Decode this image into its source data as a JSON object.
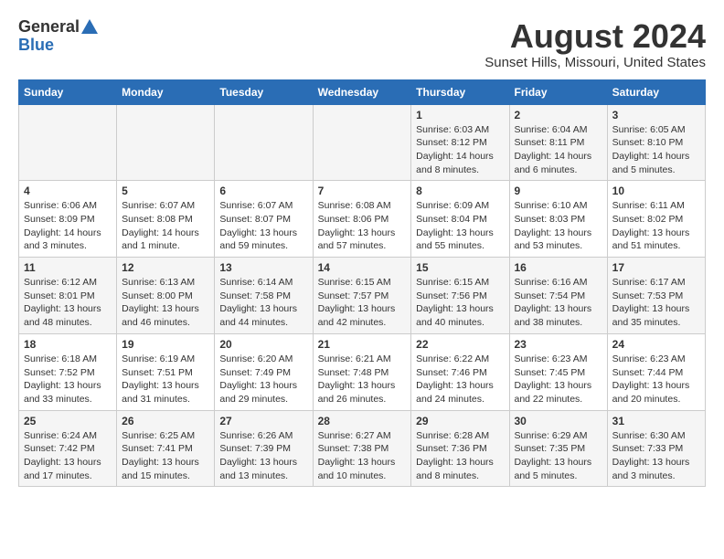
{
  "header": {
    "logo_general": "General",
    "logo_blue": "Blue",
    "month_title": "August 2024",
    "location": "Sunset Hills, Missouri, United States"
  },
  "days_of_week": [
    "Sunday",
    "Monday",
    "Tuesday",
    "Wednesday",
    "Thursday",
    "Friday",
    "Saturday"
  ],
  "weeks": [
    [
      {
        "day": "",
        "info": ""
      },
      {
        "day": "",
        "info": ""
      },
      {
        "day": "",
        "info": ""
      },
      {
        "day": "",
        "info": ""
      },
      {
        "day": "1",
        "info": "Sunrise: 6:03 AM\nSunset: 8:12 PM\nDaylight: 14 hours\nand 8 minutes."
      },
      {
        "day": "2",
        "info": "Sunrise: 6:04 AM\nSunset: 8:11 PM\nDaylight: 14 hours\nand 6 minutes."
      },
      {
        "day": "3",
        "info": "Sunrise: 6:05 AM\nSunset: 8:10 PM\nDaylight: 14 hours\nand 5 minutes."
      }
    ],
    [
      {
        "day": "4",
        "info": "Sunrise: 6:06 AM\nSunset: 8:09 PM\nDaylight: 14 hours\nand 3 minutes."
      },
      {
        "day": "5",
        "info": "Sunrise: 6:07 AM\nSunset: 8:08 PM\nDaylight: 14 hours\nand 1 minute."
      },
      {
        "day": "6",
        "info": "Sunrise: 6:07 AM\nSunset: 8:07 PM\nDaylight: 13 hours\nand 59 minutes."
      },
      {
        "day": "7",
        "info": "Sunrise: 6:08 AM\nSunset: 8:06 PM\nDaylight: 13 hours\nand 57 minutes."
      },
      {
        "day": "8",
        "info": "Sunrise: 6:09 AM\nSunset: 8:04 PM\nDaylight: 13 hours\nand 55 minutes."
      },
      {
        "day": "9",
        "info": "Sunrise: 6:10 AM\nSunset: 8:03 PM\nDaylight: 13 hours\nand 53 minutes."
      },
      {
        "day": "10",
        "info": "Sunrise: 6:11 AM\nSunset: 8:02 PM\nDaylight: 13 hours\nand 51 minutes."
      }
    ],
    [
      {
        "day": "11",
        "info": "Sunrise: 6:12 AM\nSunset: 8:01 PM\nDaylight: 13 hours\nand 48 minutes."
      },
      {
        "day": "12",
        "info": "Sunrise: 6:13 AM\nSunset: 8:00 PM\nDaylight: 13 hours\nand 46 minutes."
      },
      {
        "day": "13",
        "info": "Sunrise: 6:14 AM\nSunset: 7:58 PM\nDaylight: 13 hours\nand 44 minutes."
      },
      {
        "day": "14",
        "info": "Sunrise: 6:15 AM\nSunset: 7:57 PM\nDaylight: 13 hours\nand 42 minutes."
      },
      {
        "day": "15",
        "info": "Sunrise: 6:15 AM\nSunset: 7:56 PM\nDaylight: 13 hours\nand 40 minutes."
      },
      {
        "day": "16",
        "info": "Sunrise: 6:16 AM\nSunset: 7:54 PM\nDaylight: 13 hours\nand 38 minutes."
      },
      {
        "day": "17",
        "info": "Sunrise: 6:17 AM\nSunset: 7:53 PM\nDaylight: 13 hours\nand 35 minutes."
      }
    ],
    [
      {
        "day": "18",
        "info": "Sunrise: 6:18 AM\nSunset: 7:52 PM\nDaylight: 13 hours\nand 33 minutes."
      },
      {
        "day": "19",
        "info": "Sunrise: 6:19 AM\nSunset: 7:51 PM\nDaylight: 13 hours\nand 31 minutes."
      },
      {
        "day": "20",
        "info": "Sunrise: 6:20 AM\nSunset: 7:49 PM\nDaylight: 13 hours\nand 29 minutes."
      },
      {
        "day": "21",
        "info": "Sunrise: 6:21 AM\nSunset: 7:48 PM\nDaylight: 13 hours\nand 26 minutes."
      },
      {
        "day": "22",
        "info": "Sunrise: 6:22 AM\nSunset: 7:46 PM\nDaylight: 13 hours\nand 24 minutes."
      },
      {
        "day": "23",
        "info": "Sunrise: 6:23 AM\nSunset: 7:45 PM\nDaylight: 13 hours\nand 22 minutes."
      },
      {
        "day": "24",
        "info": "Sunrise: 6:23 AM\nSunset: 7:44 PM\nDaylight: 13 hours\nand 20 minutes."
      }
    ],
    [
      {
        "day": "25",
        "info": "Sunrise: 6:24 AM\nSunset: 7:42 PM\nDaylight: 13 hours\nand 17 minutes."
      },
      {
        "day": "26",
        "info": "Sunrise: 6:25 AM\nSunset: 7:41 PM\nDaylight: 13 hours\nand 15 minutes."
      },
      {
        "day": "27",
        "info": "Sunrise: 6:26 AM\nSunset: 7:39 PM\nDaylight: 13 hours\nand 13 minutes."
      },
      {
        "day": "28",
        "info": "Sunrise: 6:27 AM\nSunset: 7:38 PM\nDaylight: 13 hours\nand 10 minutes."
      },
      {
        "day": "29",
        "info": "Sunrise: 6:28 AM\nSunset: 7:36 PM\nDaylight: 13 hours\nand 8 minutes."
      },
      {
        "day": "30",
        "info": "Sunrise: 6:29 AM\nSunset: 7:35 PM\nDaylight: 13 hours\nand 5 minutes."
      },
      {
        "day": "31",
        "info": "Sunrise: 6:30 AM\nSunset: 7:33 PM\nDaylight: 13 hours\nand 3 minutes."
      }
    ]
  ]
}
